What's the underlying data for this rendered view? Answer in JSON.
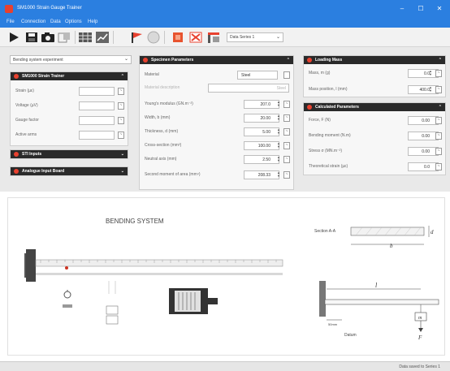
{
  "window": {
    "title": "SM1000 Strain Gauge Trainer",
    "controls": [
      "–",
      "☐",
      "✕"
    ]
  },
  "menu": [
    "File",
    "Connection",
    "Data",
    "Options",
    "Help"
  ],
  "toolbar": {
    "series_select": "Data Series 1",
    "buttons": [
      "play-icon",
      "save-icon",
      "camera-icon",
      "export-icon",
      "table-icon",
      "chart-icon",
      "flag-icon",
      "help-icon",
      "settings-icon",
      "delete-icon",
      "clear-icon"
    ]
  },
  "experiment_select": "Bending system experiment",
  "sm1000": {
    "title": "SM1000 Strain Trainer",
    "rows": [
      {
        "label": "Strain (µε)",
        "value": "",
        "icon": "~"
      },
      {
        "label": "Voltage (µV)",
        "value": "",
        "icon": "~"
      },
      {
        "label": "Gauge factor",
        "value": "",
        "icon": "~"
      },
      {
        "label": "Active arms",
        "value": "",
        "icon": "~"
      }
    ]
  },
  "sti": {
    "title": "STI Inputs"
  },
  "analogue": {
    "title": "Analogue Input Board"
  },
  "specimen": {
    "title": "Specimen Parameters",
    "material_label": "Material",
    "material_value": "Steel",
    "description_label": "Material description",
    "description_value": "Steel",
    "rows": [
      {
        "label": "Young's modulus (GN.m⁻²)",
        "value": "207.0"
      },
      {
        "label": "Width, b (mm)",
        "value": "20.00"
      },
      {
        "label": "Thickness, d (mm)",
        "value": "5.00"
      },
      {
        "label": "Cross-section (mm²)",
        "value": "100.00"
      },
      {
        "label": "Neutral axis (mm)",
        "value": "2.50"
      },
      {
        "label": "Second moment of area (mm⁴)",
        "value": "208.33"
      }
    ]
  },
  "loading": {
    "title": "Loading Mass",
    "rows": [
      {
        "label": "Mass, m (g)",
        "value": "0.0"
      },
      {
        "label": "Mass position, l (mm)",
        "value": "400.0"
      }
    ]
  },
  "calculated": {
    "title": "Calculated Parameters",
    "rows": [
      {
        "label": "Force, F (N)",
        "value": "0.00"
      },
      {
        "label": "Bending moment (N.m)",
        "value": "0.00"
      },
      {
        "label": "Stress σ (MN.m⁻²)",
        "value": "0.00"
      },
      {
        "label": "Theoretical strain (µε)",
        "value": "0.0"
      }
    ]
  },
  "diagram": {
    "heading": "BENDING SYSTEM",
    "section_label": "Section A-A",
    "dim_d": "d",
    "dim_b": "b",
    "dim_l": "l",
    "mass_label": "m",
    "force_label": "F",
    "datum_label": "Datum",
    "distance_label": "50mm"
  },
  "status": "Data saved to Series 1",
  "colors": {
    "title_bar": "#2b7fe0",
    "panel_header": "#2a2a2a",
    "accent_red": "#e8412f"
  }
}
